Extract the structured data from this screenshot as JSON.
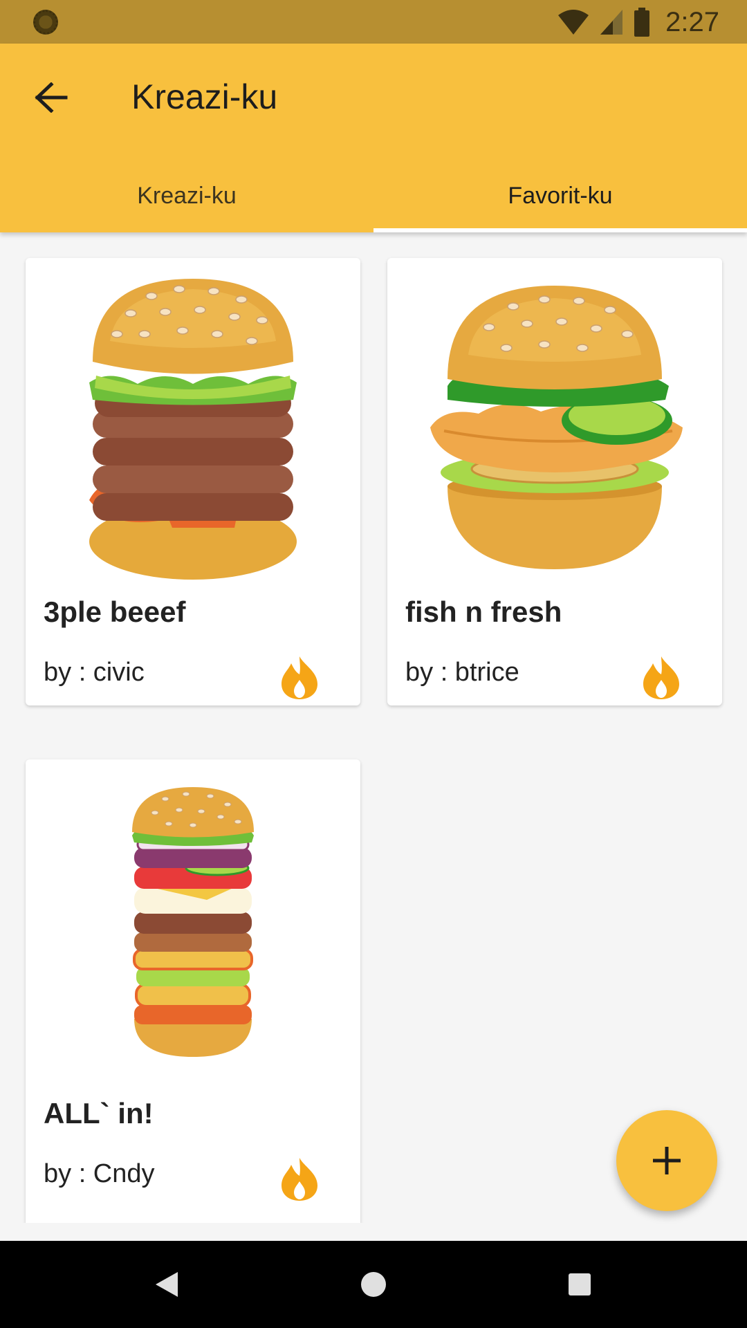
{
  "status_bar": {
    "time": "2:27",
    "icons": [
      "notification-dot-icon",
      "wifi-icon",
      "signal-icon",
      "battery-icon"
    ]
  },
  "app_bar": {
    "title": "Kreazi-ku",
    "back_icon": "arrow-back-icon"
  },
  "tabs": [
    {
      "label": "Kreazi-ku",
      "selected": false
    },
    {
      "label": "Favorit-ku",
      "selected": true
    }
  ],
  "cards": [
    {
      "title": "3ple beeef",
      "author": "by : civic",
      "image": "triple-beef-burger-illustration",
      "icon": "fire-icon"
    },
    {
      "title": "fish n fresh",
      "author": "by : btrice",
      "image": "fish-burger-illustration",
      "icon": "fire-icon"
    },
    {
      "title": "ALL` in!",
      "author": "by : Cndy",
      "image": "tall-stacked-burger-illustration",
      "icon": "fire-icon"
    }
  ],
  "fab": {
    "icon": "plus-icon"
  },
  "colors": {
    "status_bar": "#b78f31",
    "app_bar": "#f8c03e",
    "fire": "#f5a516",
    "background": "#f5f5f5"
  },
  "nav": {
    "icons": [
      "back-triangle-icon",
      "home-circle-icon",
      "recents-square-icon"
    ]
  }
}
